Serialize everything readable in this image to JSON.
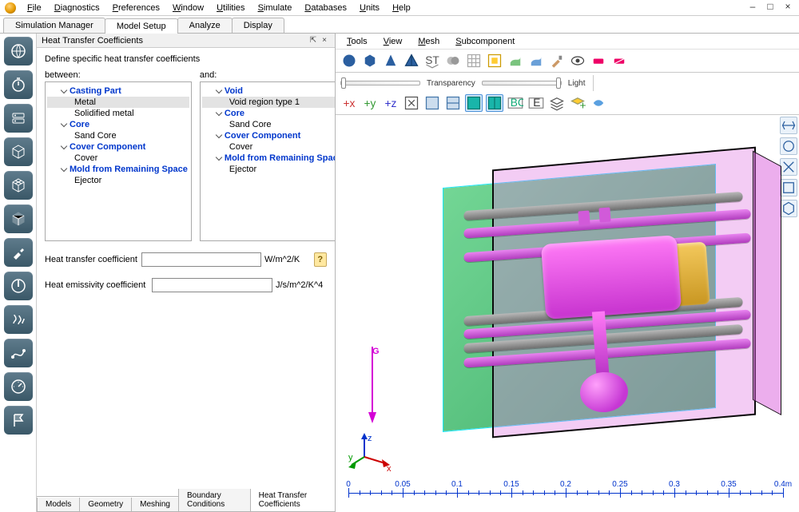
{
  "menubar": {
    "items": [
      "File",
      "Diagnostics",
      "Preferences",
      "Window",
      "Utilities",
      "Simulate",
      "Databases",
      "Units",
      "Help"
    ]
  },
  "window_controls": {
    "min": "–",
    "max": "□",
    "close": "×"
  },
  "tabs": {
    "items": [
      "Simulation Manager",
      "Model Setup",
      "Analyze",
      "Display"
    ],
    "active_index": 1
  },
  "panel": {
    "title": "Heat Transfer Coefficients",
    "desc": "Define specific heat transfer coefficients",
    "col_labels": {
      "left": "between:",
      "right": "and:"
    },
    "left_tree": [
      {
        "type": "group",
        "label": "Casting Part"
      },
      {
        "type": "item",
        "label": "Metal",
        "selected": true
      },
      {
        "type": "item",
        "label": "Solidified metal"
      },
      {
        "type": "group",
        "label": "Core"
      },
      {
        "type": "item",
        "label": "Sand Core"
      },
      {
        "type": "group",
        "label": "Cover Component"
      },
      {
        "type": "item",
        "label": "Cover"
      },
      {
        "type": "group",
        "label": "Mold from Remaining Space"
      },
      {
        "type": "item",
        "label": "Ejector"
      }
    ],
    "right_tree": [
      {
        "type": "group",
        "label": "Void"
      },
      {
        "type": "item",
        "label": "Void region type 1",
        "selected": true
      },
      {
        "type": "group",
        "label": "Core"
      },
      {
        "type": "item",
        "label": "Sand Core"
      },
      {
        "type": "group",
        "label": "Cover Component"
      },
      {
        "type": "item",
        "label": "Cover"
      },
      {
        "type": "group",
        "label": "Mold from Remaining Space"
      },
      {
        "type": "item",
        "label": "Ejector"
      }
    ],
    "fields": {
      "htc_label": "Heat transfer coefficient",
      "htc_value": "",
      "htc_unit": "W/m^2/K",
      "hec_label": "Heat emissivity coefficient",
      "hec_value": "",
      "hec_unit": "J/s/m^2/K^4"
    },
    "bottom_tabs": [
      "Models",
      "Geometry",
      "Meshing",
      "Boundary Conditions",
      "Heat Transfer Coefficients"
    ],
    "bottom_active_index": 4
  },
  "viewport": {
    "menu": [
      "Tools",
      "View",
      "Mesh",
      "Subcomponent"
    ],
    "toolbar2": {
      "transparency_label": "Transparency",
      "light_label": "Light"
    },
    "axis_label": "G",
    "axis_names": {
      "x": "x",
      "y": "y",
      "z": "z"
    },
    "ruler": {
      "ticks": [
        {
          "pos": 0.0,
          "label": "0"
        },
        {
          "pos": 0.125,
          "label": "0.05"
        },
        {
          "pos": 0.25,
          "label": "0.1"
        },
        {
          "pos": 0.375,
          "label": "0.15"
        },
        {
          "pos": 0.5,
          "label": "0.2"
        },
        {
          "pos": 0.625,
          "label": "0.25"
        },
        {
          "pos": 0.75,
          "label": "0.3"
        },
        {
          "pos": 0.875,
          "label": "0.35"
        },
        {
          "pos": 1.0,
          "label": "0.4m"
        }
      ]
    }
  },
  "icons": {
    "sidebar": [
      "globe",
      "stopwatch",
      "server",
      "box3d",
      "mesh-cube",
      "shaded-cube",
      "probe",
      "power",
      "heatwave",
      "spline",
      "dial",
      "flag"
    ],
    "vp_row1": [
      "sphere",
      "cube",
      "cone",
      "pyramid",
      "stl",
      "assembly",
      "grid-select",
      "grid-target",
      "paint",
      "paint2",
      "brush",
      "eye",
      "eraser",
      "eraser2"
    ],
    "vp_row2_right": [
      "axis-x",
      "axis-y",
      "axis-z",
      "fit",
      "clip1",
      "clip2",
      "clip3",
      "section1",
      "tag-bc",
      "tag-e",
      "layers",
      "add-layer",
      "clear"
    ]
  }
}
